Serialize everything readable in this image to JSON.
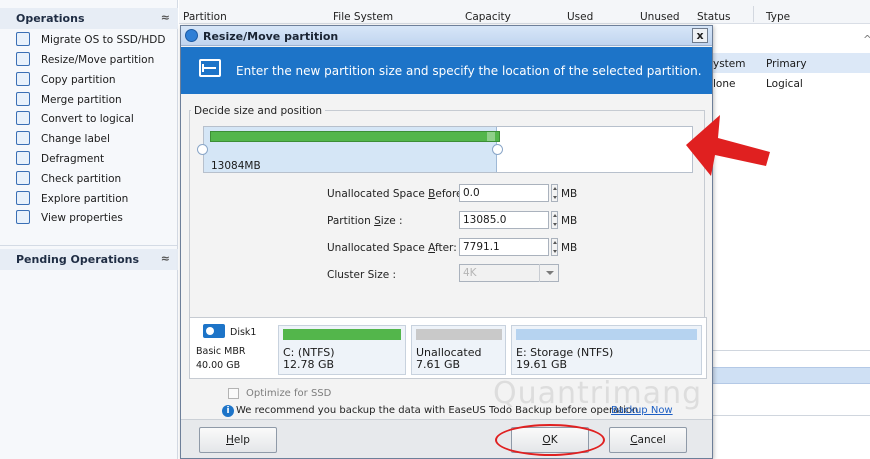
{
  "sidebar": {
    "operations_title": "Operations",
    "items": [
      {
        "label": "Migrate OS to SSD/HDD",
        "icon": "migrate-icon"
      },
      {
        "label": "Resize/Move partition",
        "icon": "resize-icon"
      },
      {
        "label": "Copy partition",
        "icon": "copy-icon"
      },
      {
        "label": "Merge partition",
        "icon": "merge-icon"
      },
      {
        "label": "Convert to logical",
        "icon": "convert-icon"
      },
      {
        "label": "Change label",
        "icon": "label-icon"
      },
      {
        "label": "Defragment",
        "icon": "defragment-icon"
      },
      {
        "label": "Check partition",
        "icon": "check-icon"
      },
      {
        "label": "Explore partition",
        "icon": "explore-icon"
      },
      {
        "label": "View properties",
        "icon": "properties-icon"
      }
    ],
    "pending_title": "Pending Operations",
    "collapse_glyph": "≈"
  },
  "table": {
    "columns": [
      "Partition",
      "File System",
      "Capacity",
      "Used",
      "Unused",
      "Status",
      "Type"
    ],
    "rows": [
      {
        "status": "ystem",
        "type": "Primary"
      },
      {
        "status": "lone",
        "type": "Logical"
      }
    ],
    "scroll_glyph": "^"
  },
  "dialog": {
    "title": "Resize/Move partition",
    "close_glyph": "x",
    "banner_text": "Enter the new partition size and specify the location of the selected partition.",
    "group_label": "Decide size and position",
    "partition_size_display": "13084MB",
    "partition_fill_fraction": 0.6,
    "fields": {
      "before_label_pre": "Unallocated Space ",
      "before_label_key": "B",
      "before_label_post": "efore:",
      "before_value": "0.0",
      "size_label_pre": "Partition ",
      "size_label_key": "S",
      "size_label_post": "ize :",
      "size_value": "13085.0",
      "after_label_pre": "Unallocated Space ",
      "after_label_key": "A",
      "after_label_post": "fter:",
      "after_value": "7791.1",
      "cluster_label": "Cluster Size :",
      "cluster_value": "4K",
      "unit": "MB"
    },
    "disk": {
      "name": "Disk1",
      "type": "Basic MBR",
      "size": "40.00 GB",
      "partitions": [
        {
          "name": "C: (NTFS)",
          "size": "12.78 GB",
          "color": "#53b64b"
        },
        {
          "name": "Unallocated",
          "size": "7.61 GB",
          "color": "#c9c9c9"
        },
        {
          "name": "E: Storage (NTFS)",
          "size": "19.61 GB",
          "color": "#b6d3f0"
        }
      ]
    },
    "optimize_label": "Optimize for SSD",
    "info_text": "We recommend you backup the data with EaseUS Todo Backup before operation.",
    "backup_link": "Backup Now",
    "buttons": {
      "help_key": "H",
      "help_rest": "elp",
      "ok_key": "O",
      "ok_rest": "K",
      "cancel_key": "C",
      "cancel_rest": "ancel"
    }
  },
  "watermark": "Quantrimang",
  "colors": {
    "accent": "#1d74c8",
    "annotation": "#e02020"
  }
}
